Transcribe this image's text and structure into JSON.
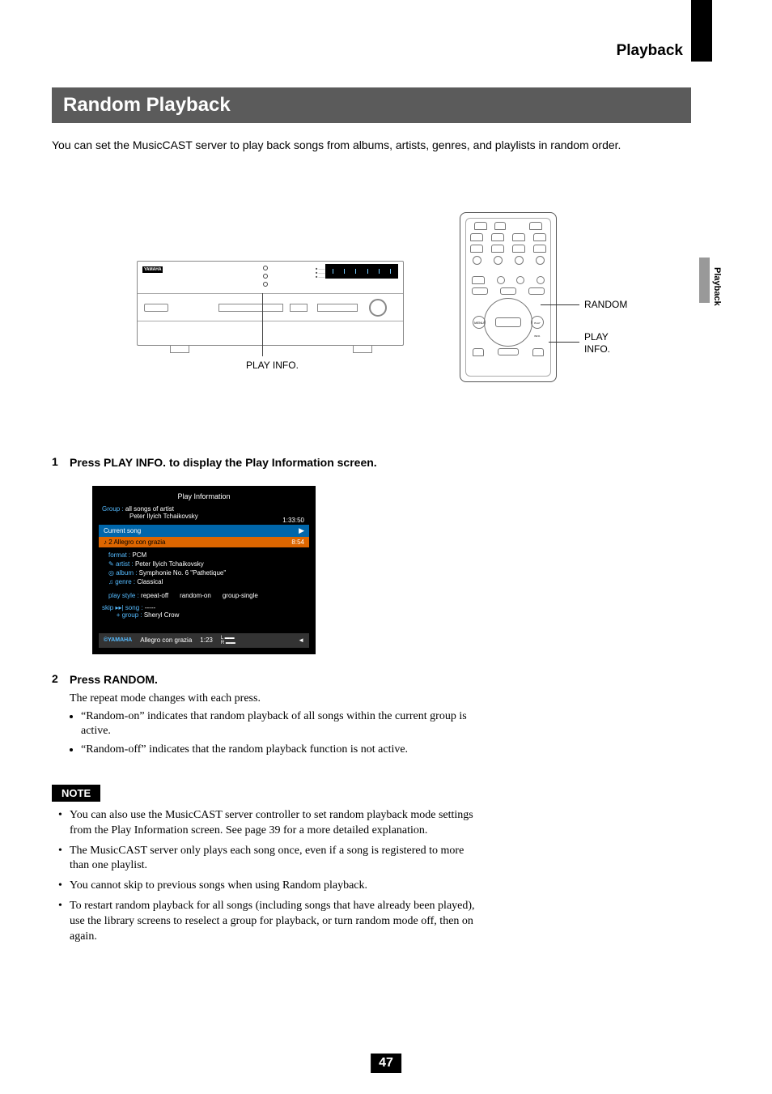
{
  "side_label": "Playback",
  "header": "Playback",
  "title": "Random Playback",
  "intro": "You can set the MusicCAST server to play back songs from albums, artists, genres, and playlists in random order.",
  "figures": {
    "device_brand": "YAMAHA",
    "play_info_label": "PLAY INFO.",
    "random_label": "RANDOM",
    "play_callout_l1": "PLAY",
    "play_callout_l2": "INFO."
  },
  "steps": [
    {
      "num": "1",
      "title": "Press PLAY INFO. to display the Play Information screen."
    },
    {
      "num": "2",
      "title": "Press RANDOM.",
      "desc": "The repeat mode changes with each press.",
      "bullets": [
        "“Random-on” indicates that random playback of all songs within the current group is active.",
        "“Random-off” indicates that the random playback function is not active."
      ]
    }
  ],
  "screen": {
    "title": "Play Information",
    "group_label": "Group :",
    "group_value_l1": "all songs of artist",
    "group_value_l2": "Peter Ilyich Tchaikovsky",
    "total_time": "1:33:50",
    "current_song_label": "Current song",
    "track_no": "2",
    "track_name": "Allegro con grazia",
    "track_time": "8:54",
    "format_label": "format :",
    "format_value": "PCM",
    "artist_label": "artist :",
    "artist_value": "Peter Ilyich Tchaikovsky",
    "album_label": "album :",
    "album_value": "Symphonie No. 6 \"Pathetique\"",
    "genre_label": "genre :",
    "genre_value": "Classical",
    "playstyle_label": "play style :",
    "playstyle_repeat": "repeat-off",
    "playstyle_random": "random-on",
    "playstyle_group": "group-single",
    "skip_label": "skip",
    "skip_song_label": "song :",
    "skip_song_value": "-----",
    "skip_group_label": "group :",
    "skip_group_value": "Sheryl Crow",
    "footer_brand": "©YAMAHA",
    "footer_track": "Allegro con grazia",
    "footer_time": "1:23"
  },
  "note": {
    "heading": "NOTE",
    "items": [
      "You can also use the MusicCAST server controller to set random playback mode settings from the Play Information screen. See page 39 for a more detailed explanation.",
      "The MusicCAST server only plays each song once, even if a song is registered to more than one playlist.",
      "You cannot skip to previous songs when using Random playback.",
      "To restart random playback for all songs (including songs that have already been played), use the library screens to reselect a group for playback, or turn random mode off, then on again."
    ]
  },
  "page_number": "47"
}
